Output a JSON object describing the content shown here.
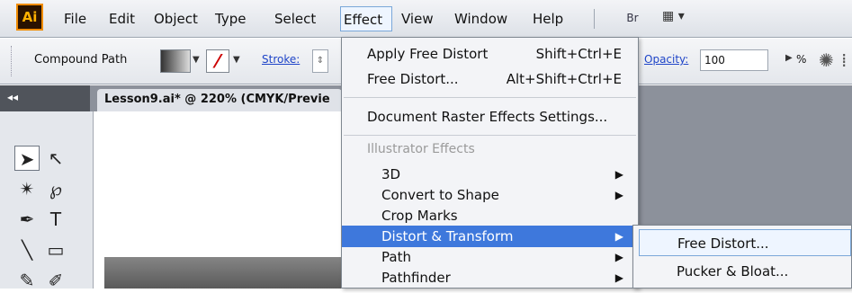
{
  "app": {
    "logo": "Ai"
  },
  "menubar": {
    "items": [
      "File",
      "Edit",
      "Object",
      "Type",
      "Select",
      "Effect",
      "View",
      "Window",
      "Help"
    ],
    "active": "Effect",
    "bridge_label": "Br",
    "arrange_label": "▾"
  },
  "controlbar": {
    "selection_type": "Compound Path",
    "stroke_label": "Stroke:",
    "opacity_label": "Opacity:",
    "opacity_value": "100",
    "opacity_unit": "%"
  },
  "document": {
    "tab_title": "Lesson9.ai* @ 220% (CMYK/Previe",
    "collapse_glyph": "◂◂"
  },
  "effect_menu": {
    "items": [
      {
        "label": "Apply Free Distort",
        "shortcut": "Shift+Ctrl+E"
      },
      {
        "label": "Free Distort...",
        "shortcut": "Alt+Shift+Ctrl+E"
      },
      {
        "label": "Document Raster Effects Settings..."
      }
    ],
    "section_header": "Illustrator Effects",
    "effects": [
      {
        "label": "3D",
        "submenu": true
      },
      {
        "label": "Convert to Shape",
        "submenu": true
      },
      {
        "label": "Crop Marks",
        "submenu": false
      },
      {
        "label": "Distort & Transform",
        "submenu": true,
        "highlighted": true
      },
      {
        "label": "Path",
        "submenu": true
      },
      {
        "label": "Pathfinder",
        "submenu": true
      }
    ]
  },
  "distort_submenu": {
    "items": [
      "Free Distort...",
      "Pucker & Bloat..."
    ]
  },
  "colors": {
    "highlight": "#3e78dc",
    "menu_bg": "#f3f4f7",
    "panel_gray": "#8c919b"
  },
  "icons": [
    "selection-tool-icon",
    "direct-selection-tool-icon",
    "magic-wand-icon",
    "lasso-icon",
    "pen-tool-icon",
    "type-tool-icon",
    "line-tool-icon",
    "rectangle-tool-icon",
    "paintbrush-icon",
    "pencil-icon",
    "blob-brush-icon",
    "eraser-icon",
    "gear-icon",
    "align-icon",
    "bridge-icon",
    "arrange-documents-icon"
  ]
}
